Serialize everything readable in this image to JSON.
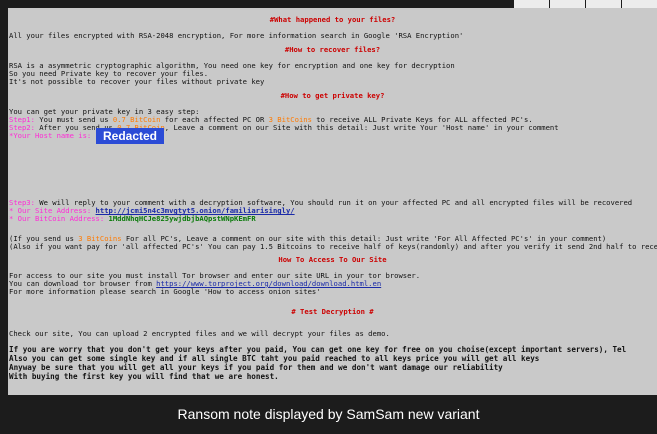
{
  "note": {
    "h1": "#What happened to your files?",
    "l1": "All your files encrypted with RSA-2048 encryption, For more information search in Google 'RSA Encryption'",
    "h2": "#How to recover files?",
    "l2a": "RSA is a asymmetric cryptographic algorithm, You need one key for encryption and one key for decryption",
    "l2b": "So you need Private key to recover your files.",
    "l2c": "It's not possible to recover your files without private key",
    "h3": "#How to get private key?",
    "l3a": "You can get your private key in 3 easy step:",
    "step1_label": "Step1:",
    "step1_a": " You must send us ",
    "step1_amount": "0.7 BitCoin",
    "step1_b": " for each affected PC OR ",
    "step1_amount2": "3 BitCoins",
    "step1_c": " to receive ALL Private Keys for ALL affected PC's.",
    "step2_label": "Step2:",
    "step2_a": " After you send us ",
    "step2_amount": "0.7 BitCoin",
    "step2_b": ", Leave a comment on our Site with this detail: Just write Your 'Host name' in your comment",
    "host_label": "*Your Host name is:",
    "redacted": "Redacted",
    "step3_label": "Step3:",
    "step3_text": " We will reply to your comment with a decryption software, You should run it on your affected PC and all encrypted files will be recovered",
    "site_label": "* Our Site Address: ",
    "site_value": "http://jcmi5n4c3mvgtyt5.onion/familiarisingly/",
    "btc_label": "* Our BitCoin Address: ",
    "btc_value": "1MddNhqHCJe825ywjdbjbAQpstWNpKEmFR",
    "all_a": "(If you send us ",
    "all_amount": "3 BitCoins",
    "all_b": " For all PC's, Leave a comment on our site with this detail: Just write 'For All Affected PC's' in your comment)",
    "half": "(Also if you want pay for 'all affected PC's' You can pay 1.5 Bitcoins to receive half of keys(randomly) and after you verify it send 2nd half to receive all",
    "h4": "How To Access To Our Site",
    "tor1": "For access to our site you must install Tor browser and enter our site URL in your tor browser.",
    "tor2a": "You can download tor browser from ",
    "tor2_link": "https://www.torproject.org/download/download.html.en",
    "tor3": "For more information please search in Google 'How to access onion sites'",
    "h5": "# Test Decryption #",
    "test1": "Check our site, You can upload 2 encrypted files and we will decrypt your files as demo.",
    "b1": "If you are worry that you don't get your keys after you paid, You can get one key for free on you choise(except important servers), Tel",
    "b2": "Also you can get some single key and if all single BTC taht you paid reached to all keys price you will get all keys",
    "b3": "Anyway be sure that you will get all your keys if you paid for them and we don't want damage our reliability",
    "b4": "With buying the first key you will find that we are honest."
  },
  "caption": "Ransom note displayed by SamSam new variant"
}
